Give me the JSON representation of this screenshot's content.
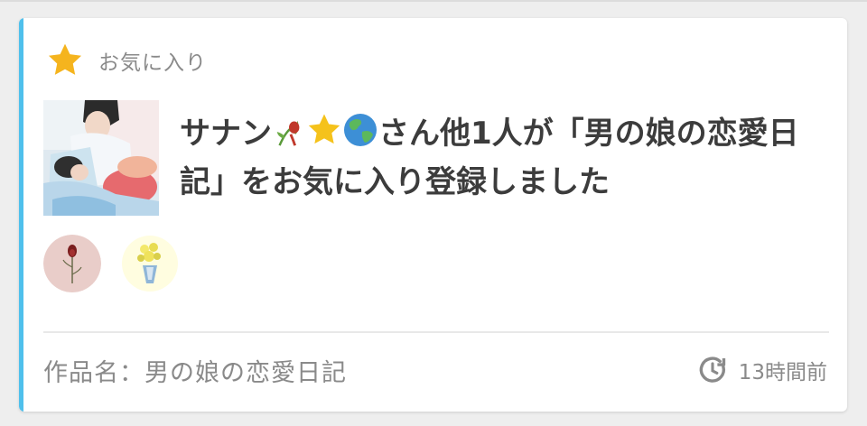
{
  "header": {
    "icon": "star-icon",
    "label": "お気に入り"
  },
  "notification": {
    "thumbnail": "work-thumbnail",
    "user_name": "サナン",
    "user_emojis": [
      "wilted-rose-emoji",
      "star-emoji",
      "globe-emoji"
    ],
    "message_rest": "さん他1人が「男の娘の恋愛日記」をお気に入り登録しました"
  },
  "avatars": [
    {
      "name": "avatar-rose"
    },
    {
      "name": "avatar-bouquet"
    }
  ],
  "footer": {
    "work_title": "作品名：男の娘の恋愛日記",
    "time_icon": "clock-icon",
    "time_label": "13時間前"
  },
  "colors": {
    "accent": "#4fc0ec",
    "star": "#f5b41e",
    "title_text": "#3c3c3c",
    "muted_text": "#8a8a8a"
  }
}
